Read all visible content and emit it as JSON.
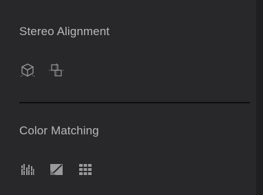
{
  "stereo_alignment": {
    "title": "Stereo Alignment",
    "icons": [
      "stereo-cube-icon",
      "stereo-align-icon"
    ]
  },
  "color_matching": {
    "title": "Color Matching",
    "icons": [
      "color-bars-icon",
      "color-curve-icon",
      "color-grid-icon"
    ]
  },
  "colors": {
    "panel_bg": "#28282a",
    "text": "#b9b9bb",
    "icon": "#9a9a9c",
    "divider": "#0d0d0e"
  }
}
